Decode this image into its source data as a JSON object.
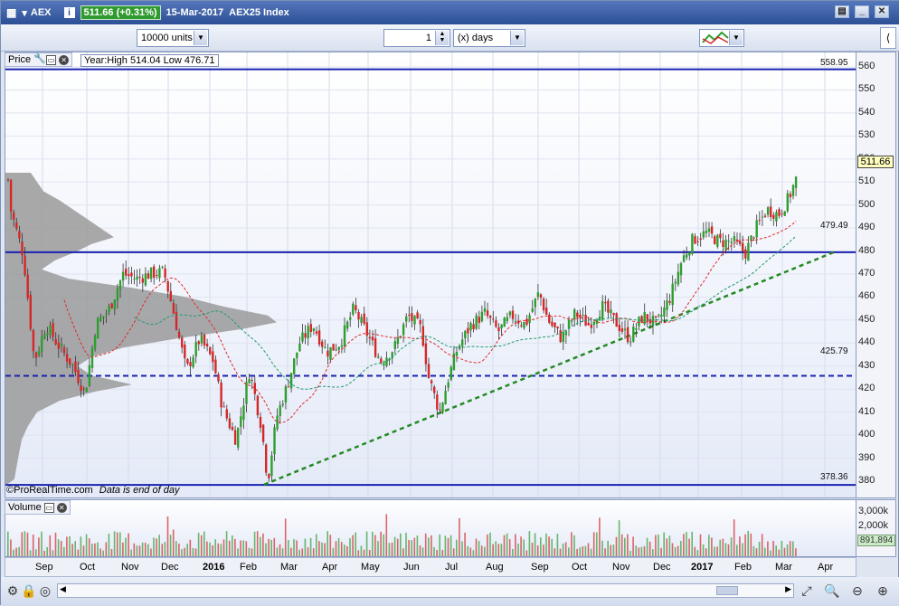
{
  "title": {
    "symbol": "AEX",
    "price_change": "511.66 (+0.31%)",
    "date": "15-Mar-2017",
    "name": "AEX25 Index"
  },
  "toolbar": {
    "units": "10000 units",
    "period_value": "1",
    "period_unit": "(x) days"
  },
  "price_panel": {
    "label": "Price",
    "info": "Year:High 514.04 Low 476.71",
    "current": "511.66",
    "levels": [
      {
        "value": "558.95"
      },
      {
        "value": "479.49"
      },
      {
        "value": "425.79"
      },
      {
        "value": "378.36"
      }
    ],
    "footnote_brand": "©ProRealTime.com",
    "footnote_note": "Data is end of day"
  },
  "y_ticks": [
    "560",
    "550",
    "540",
    "530",
    "520",
    "510",
    "500",
    "490",
    "480",
    "470",
    "460",
    "450",
    "440",
    "430",
    "420",
    "410",
    "400",
    "390",
    "380"
  ],
  "volume_panel": {
    "label": "Volume",
    "ticks": [
      "3,000k",
      "2,000k"
    ],
    "current": "891,894"
  },
  "x_labels": [
    {
      "label": "Sep",
      "bold": false
    },
    {
      "label": "Oct",
      "bold": false
    },
    {
      "label": "Nov",
      "bold": false
    },
    {
      "label": "Dec",
      "bold": false
    },
    {
      "label": "2016",
      "bold": true
    },
    {
      "label": "Feb",
      "bold": false
    },
    {
      "label": "Mar",
      "bold": false
    },
    {
      "label": "Apr",
      "bold": false
    },
    {
      "label": "May",
      "bold": false
    },
    {
      "label": "Jun",
      "bold": false
    },
    {
      "label": "Jul",
      "bold": false
    },
    {
      "label": "Aug",
      "bold": false
    },
    {
      "label": "Sep",
      "bold": false
    },
    {
      "label": "Oct",
      "bold": false
    },
    {
      "label": "Nov",
      "bold": false
    },
    {
      "label": "Dec",
      "bold": false
    },
    {
      "label": "2017",
      "bold": true
    },
    {
      "label": "Feb",
      "bold": false
    },
    {
      "label": "Mar",
      "bold": false
    },
    {
      "label": "Apr",
      "bold": false
    }
  ],
  "colors": {
    "up": "#2e9e2e",
    "down": "#d42828",
    "level_line": "#1a22b0",
    "trend_line": "#238a23"
  }
}
